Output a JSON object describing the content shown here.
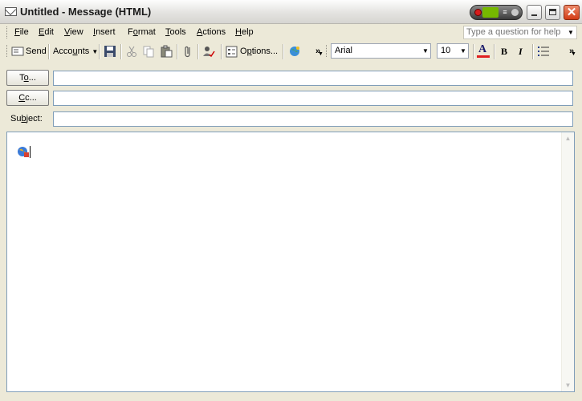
{
  "window": {
    "title": "Untitled - Message (HTML)"
  },
  "menu": {
    "items": [
      {
        "pre": "",
        "u": "F",
        "post": "ile"
      },
      {
        "pre": "",
        "u": "E",
        "post": "dit"
      },
      {
        "pre": "",
        "u": "V",
        "post": "iew"
      },
      {
        "pre": "",
        "u": "I",
        "post": "nsert"
      },
      {
        "pre": "F",
        "u": "o",
        "post": "rmat"
      },
      {
        "pre": "",
        "u": "T",
        "post": "ools"
      },
      {
        "pre": "",
        "u": "A",
        "post": "ctions"
      },
      {
        "pre": "",
        "u": "H",
        "post": "elp"
      }
    ],
    "ask_placeholder": "Type a question for help"
  },
  "toolbar": {
    "send_label": "Send",
    "accounts_pre": "Acco",
    "accounts_u": "u",
    "accounts_post": "nts",
    "options_pre": "O",
    "options_u": "p",
    "options_post": "tions...",
    "font": "Arial",
    "size": "10",
    "bold": "B",
    "italic": "I",
    "more": "»"
  },
  "address": {
    "to": {
      "pre": "T",
      "u": "o",
      "post": "..."
    },
    "cc": {
      "pre": "",
      "u": "C",
      "post": "c..."
    },
    "subject": {
      "pre": "Su",
      "u": "b",
      "post": "ject:"
    }
  },
  "colors": {
    "accent": "#d33c16",
    "field_border": "#7f9db9",
    "font_color_bar": "#e02020"
  }
}
